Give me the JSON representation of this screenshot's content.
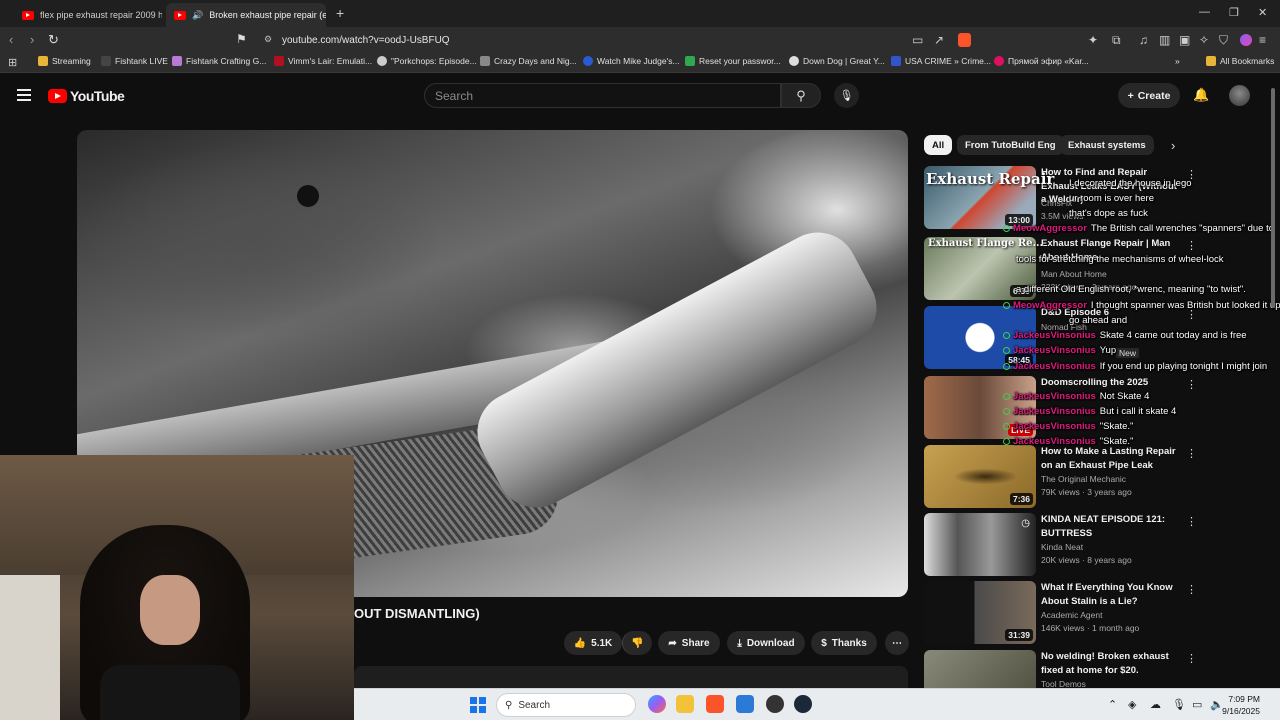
{
  "browser": {
    "tabs": [
      {
        "title": "flex pipe exhaust repair 2009 honda"
      },
      {
        "title": "Broken exhaust pipe repair (e..."
      }
    ],
    "new_tab": "+",
    "url": "youtube.com/watch?v=oodJ-UsBFUQ",
    "bookmarks": [
      {
        "label": "Streaming",
        "color": "#e8b339"
      },
      {
        "label": "Fishtank LIVE",
        "color": "#444444"
      },
      {
        "label": "Fishtank Crafting G...",
        "color": "#b97ad6"
      },
      {
        "label": "Vimm's Lair: Emulati...",
        "color": "#b01020"
      },
      {
        "label": "\"Porkchops: Episode...",
        "color": "#cccccc"
      },
      {
        "label": "Crazy Days and Nig...",
        "color": "#888888"
      },
      {
        "label": "Watch Mike Judge's...",
        "color": "#2a5bd7"
      },
      {
        "label": "Reset your passwor...",
        "color": "#2fa84f"
      },
      {
        "label": "Down Dog | Great Y...",
        "color": "#dddddd"
      },
      {
        "label": "USA CRIME » Crime...",
        "color": "#3355cc"
      },
      {
        "label": "Прямой эфир «Kar...",
        "color": "#e01060"
      }
    ],
    "all_bookmarks": "All Bookmarks"
  },
  "youtube": {
    "logo_text": "YouTube",
    "search_placeholder": "Search",
    "create_label": "Create",
    "video_title": "OUT DISMANTLING)",
    "actions": {
      "likes": "5.1K",
      "share": "Share",
      "download": "Download",
      "thanks": "Thanks"
    },
    "chips": [
      "All",
      "From TutoBuild Eng",
      "Exhaust systems"
    ],
    "recommendations": [
      {
        "title": "How to Find and Repair Exhaust Leaks EASY (Without a Welder)",
        "channel": "ChrisFix",
        "meta": "3.5M views",
        "duration": "13:00",
        "thumb": "#5a7a8a"
      },
      {
        "title": "Exhaust Flange Repair | Man About Home",
        "channel": "Man About Home",
        "meta": "223K views · 3 years ago",
        "duration": "6:39",
        "thumb": "#7a8a6a"
      },
      {
        "title": "D&D Episode 6",
        "channel": "Nomad Fish",
        "meta": "",
        "duration": "58:45",
        "thumb": "#1e4aa8",
        "badge": "New"
      },
      {
        "title": "Doomscrolling the 2025",
        "channel": "",
        "meta": "",
        "duration": "LIVE",
        "thumb": "#8a5a4a"
      },
      {
        "title": "How to Make a Lasting Repair on an Exhaust Pipe Leak",
        "channel": "The Original Mechanic",
        "meta": "79K views · 3 years ago",
        "duration": "7:36",
        "thumb": "#b08a3a"
      },
      {
        "title": "KINDA NEAT EPISODE 121: BUTTRESS",
        "channel": "Kinda Neat",
        "meta": "20K views · 8 years ago",
        "duration": "",
        "thumb": "#9a9a9a"
      },
      {
        "title": "What If Everything You Know About Stalin is a Lie?",
        "channel": "Academic Agent",
        "meta": "146K views · 1 month ago",
        "duration": "31:39",
        "thumb": "#3a3a3a"
      },
      {
        "title": "No welding! Broken exhaust fixed at home for $20.",
        "channel": "Tool Demos",
        "meta": "",
        "duration": "",
        "thumb": "#6a6a5a"
      }
    ]
  },
  "chat": {
    "header": "Exhaust Repair",
    "header2": "Exhaust Flange Re...",
    "messages": [
      {
        "user": "",
        "text": "I decorated the house in lego"
      },
      {
        "user": "",
        "text": "ur room is over here"
      },
      {
        "user": "",
        "text": "that's dope as fuck"
      },
      {
        "user": "MeowAggressor",
        "text": "The British call wrenches \"spanners\" due to"
      },
      {
        "user": "",
        "text": "tools for stretching the mechanisms of wheel-lock"
      },
      {
        "user": "",
        "text": "a different Old English root, *wrenc, meaning \"to twist\"."
      },
      {
        "user": "MeowAggressor",
        "text": "I thought spanner was British but looked it up"
      },
      {
        "user": "",
        "text": "go ahead and"
      },
      {
        "user": "JackeusVinsonius",
        "text": "Skate 4 came out today and is free"
      },
      {
        "user": "JackeusVinsonius",
        "text": "Yup"
      },
      {
        "user": "JackeusVinsonius",
        "text": "If you end up playing tonight I might join"
      },
      {
        "user": "JackeusVinsonius",
        "text": "Not Skate 4"
      },
      {
        "user": "JackeusVinsonius",
        "text": "But i call it skate 4"
      },
      {
        "user": "JackeusVinsonius",
        "text": "\"Skate.\""
      },
      {
        "user": "JackeusVinsonius",
        "text": "\"Skate.\""
      }
    ]
  },
  "taskbar": {
    "search": "Search",
    "time": "7:09 PM",
    "date": "9/16/2025"
  }
}
